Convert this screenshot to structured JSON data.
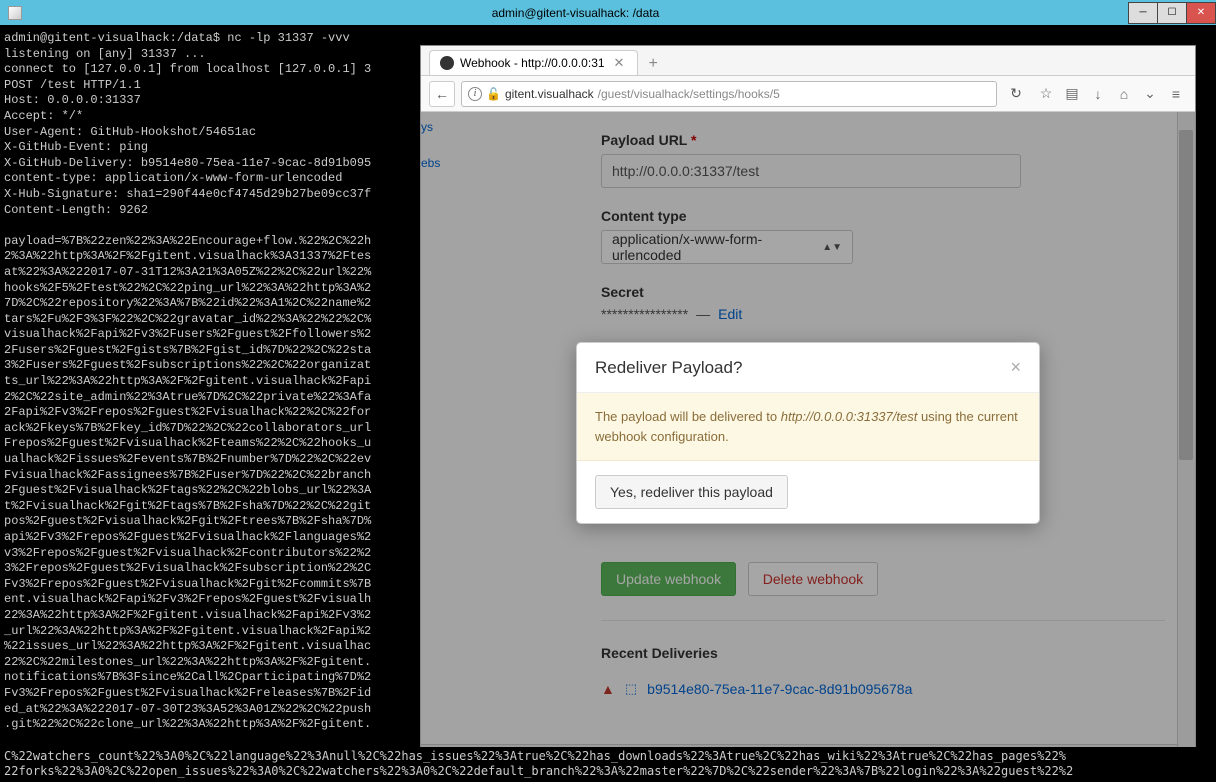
{
  "window": {
    "title": "admin@gitent-visualhack: /data"
  },
  "terminal": {
    "lines": "admin@gitent-visualhack:/data$ nc -lp 31337 -vvv\nlistening on [any] 31337 ...\nconnect to [127.0.0.1] from localhost [127.0.0.1] 3\nPOST /test HTTP/1.1\nHost: 0.0.0.0:31337\nAccept: */*\nUser-Agent: GitHub-Hookshot/54651ac\nX-GitHub-Event: ping\nX-GitHub-Delivery: b9514e80-75ea-11e7-9cac-8d91b095\ncontent-type: application/x-www-form-urlencoded\nX-Hub-Signature: sha1=290f44e0cf4745d29b27be09cc37f\nContent-Length: 9262\n\npayload=%7B%22zen%22%3A%22Encourage+flow.%22%2C%22h\n2%3A%22http%3A%2F%2Fgitent.visualhack%3A31337%2Ftes\nat%22%3A%222017-07-31T12%3A21%3A05Z%22%2C%22url%22%\nhooks%2F5%2Ftest%22%2C%22ping_url%22%3A%22http%3A%2\n7D%2C%22repository%22%3A%7B%22id%22%3A1%2C%22name%2\ntars%2Fu%2F3%3F%22%2C%22gravatar_id%22%3A%22%22%2C%\nvisualhack%2Fapi%2Fv3%2Fusers%2Fguest%2Ffollowers%2\n2Fusers%2Fguest%2Fgists%7B%2Fgist_id%7D%22%2C%22sta\n3%2Fusers%2Fguest%2Fsubscriptions%22%2C%22organizat\nts_url%22%3A%22http%3A%2F%2Fgitent.visualhack%2Fapi\n2%2C%22site_admin%22%3Atrue%7D%2C%22private%22%3Afa\n2Fapi%2Fv3%2Frepos%2Fguest%2Fvisualhack%22%2C%22for\nack%2Fkeys%7B%2Fkey_id%7D%22%2C%22collaborators_url\nFrepos%2Fguest%2Fvisualhack%2Fteams%22%2C%22hooks_u\nualhack%2Fissues%2Fevents%7B%2Fnumber%7D%22%2C%22ev\nFvisualhack%2Fassignees%7B%2Fuser%7D%22%2C%22branch\n2Fguest%2Fvisualhack%2Ftags%22%2C%22blobs_url%22%3A\nt%2Fvisualhack%2Fgit%2Ftags%7B%2Fsha%7D%22%2C%22git\npos%2Fguest%2Fvisualhack%2Fgit%2Ftrees%7B%2Fsha%7D%\napi%2Fv3%2Frepos%2Fguest%2Fvisualhack%2Flanguages%2\nv3%2Frepos%2Fguest%2Fvisualhack%2Fcontributors%22%2\n3%2Frepos%2Fguest%2Fvisualhack%2Fsubscription%22%2C\nFv3%2Frepos%2Fguest%2Fvisualhack%2Fgit%2Fcommits%7B\nent.visualhack%2Fapi%2Fv3%2Frepos%2Fguest%2Fvisualh\n22%3A%22http%3A%2F%2Fgitent.visualhack%2Fapi%2Fv3%2\n_url%22%3A%22http%3A%2F%2Fgitent.visualhack%2Fapi%2\n%22issues_url%22%3A%22http%3A%2F%2Fgitent.visualhac\n22%2C%22milestones_url%22%3A%22http%3A%2F%2Fgitent.\nnotifications%7B%3Fsince%2Call%2Cparticipating%7D%2\nFv3%2Frepos%2Fguest%2Fvisualhack%2Freleases%7B%2Fid\ned_at%22%3A%222017-07-30T23%3A52%3A01Z%22%2C%22push\n.git%22%2C%22clone_url%22%3A%22http%3A%2F%2Fgitent."
  },
  "bottom_spill": "C%22watchers_count%22%3A0%2C%22language%22%3Anull%2C%22has_issues%22%3Atrue%2C%22has_downloads%22%3Atrue%2C%22has_wiki%22%3Atrue%2C%22has_pages%22%\n22forks%22%3A0%2C%22open_issues%22%3A0%2C%22watchers%22%3A0%2C%22default_branch%22%3A%22master%22%7D%2C%22sender%22%3A%7B%22login%22%3A%22guest%22%2",
  "browser": {
    "tab_title": "Webhook - http://0.0.0.0:31",
    "url_prefix": "gitent.visualhack",
    "url_path": "/guest/visualhack/settings/hooks/5",
    "side_a": "ys",
    "side_b": "ebs",
    "labels": {
      "payload_url": "Payload URL",
      "content_type": "Content type",
      "secret": "Secret",
      "recent": "Recent Deliveries"
    },
    "payload_url_value": "http://0.0.0.0:31337/test",
    "content_type_value": "application/x-www-form-urlencoded",
    "secret_mask": "****************",
    "edit": "Edit",
    "buttons": {
      "update": "Update webhook",
      "delete": "Delete webhook"
    },
    "delivery_id": "b9514e80-75ea-11e7-9cac-8d91b095678a"
  },
  "modal": {
    "title": "Redeliver Payload?",
    "msg_pre": "The payload will be delivered to ",
    "msg_url": "http://0.0.0.0:31337/test",
    "msg_post": " using the current webhook configuration.",
    "confirm": "Yes, redeliver this payload"
  }
}
